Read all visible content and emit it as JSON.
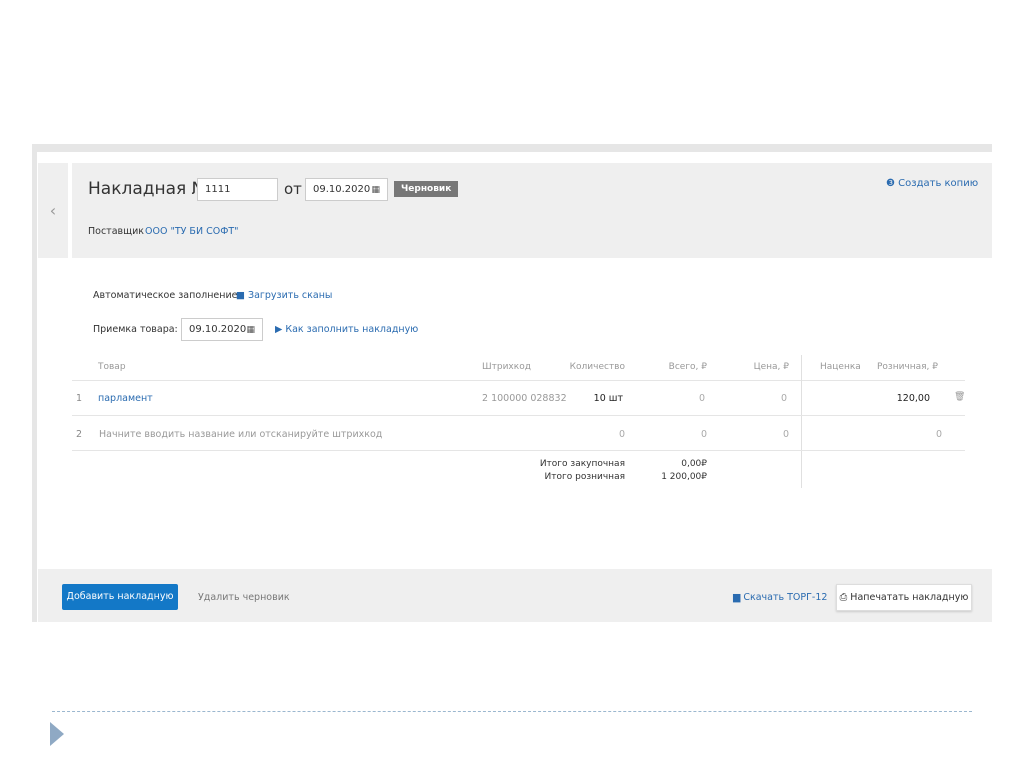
{
  "header": {
    "title": "Накладная №",
    "number": "1111",
    "from_label": "от",
    "date": "09.10.2020",
    "status": "Черновик",
    "supplier_label": "Поставщик",
    "supplier": "ООО \"ТУ БИ СОФТ\"",
    "copy_link": "Создать копию"
  },
  "autofill": {
    "label": "Автоматическое заполнение:",
    "link": "Загрузить сканы"
  },
  "receipt": {
    "label": "Приемка товара:",
    "date": "09.10.2020",
    "help_link": "Как заполнить накладную"
  },
  "table": {
    "columns": [
      "Товар",
      "Штрихкод",
      "Количество",
      "Всего, ₽",
      "Цена, ₽",
      "Наценка",
      "Розничная, ₽"
    ],
    "rows": [
      {
        "num": "1",
        "name": "парламент",
        "barcode": "2 100000 028832",
        "qty": "10 шт",
        "total": "0",
        "price": "0",
        "markup": "",
        "retail": "120,00"
      },
      {
        "num": "2",
        "placeholder": "Начните вводить название или отсканируйте штрихкод",
        "qty": "0",
        "total": "0",
        "price": "0",
        "retail": "0"
      }
    ],
    "totals": {
      "purchase_label": "Итого закупочная",
      "purchase": "0,00₽",
      "retail_label": "Итого розничная",
      "retail": "1 200,00₽"
    }
  },
  "footer": {
    "add": "Добавить накладную",
    "delete": "Удалить черновик",
    "download": "Скачать ТОРГ-12",
    "print": "Напечатать накладную"
  }
}
